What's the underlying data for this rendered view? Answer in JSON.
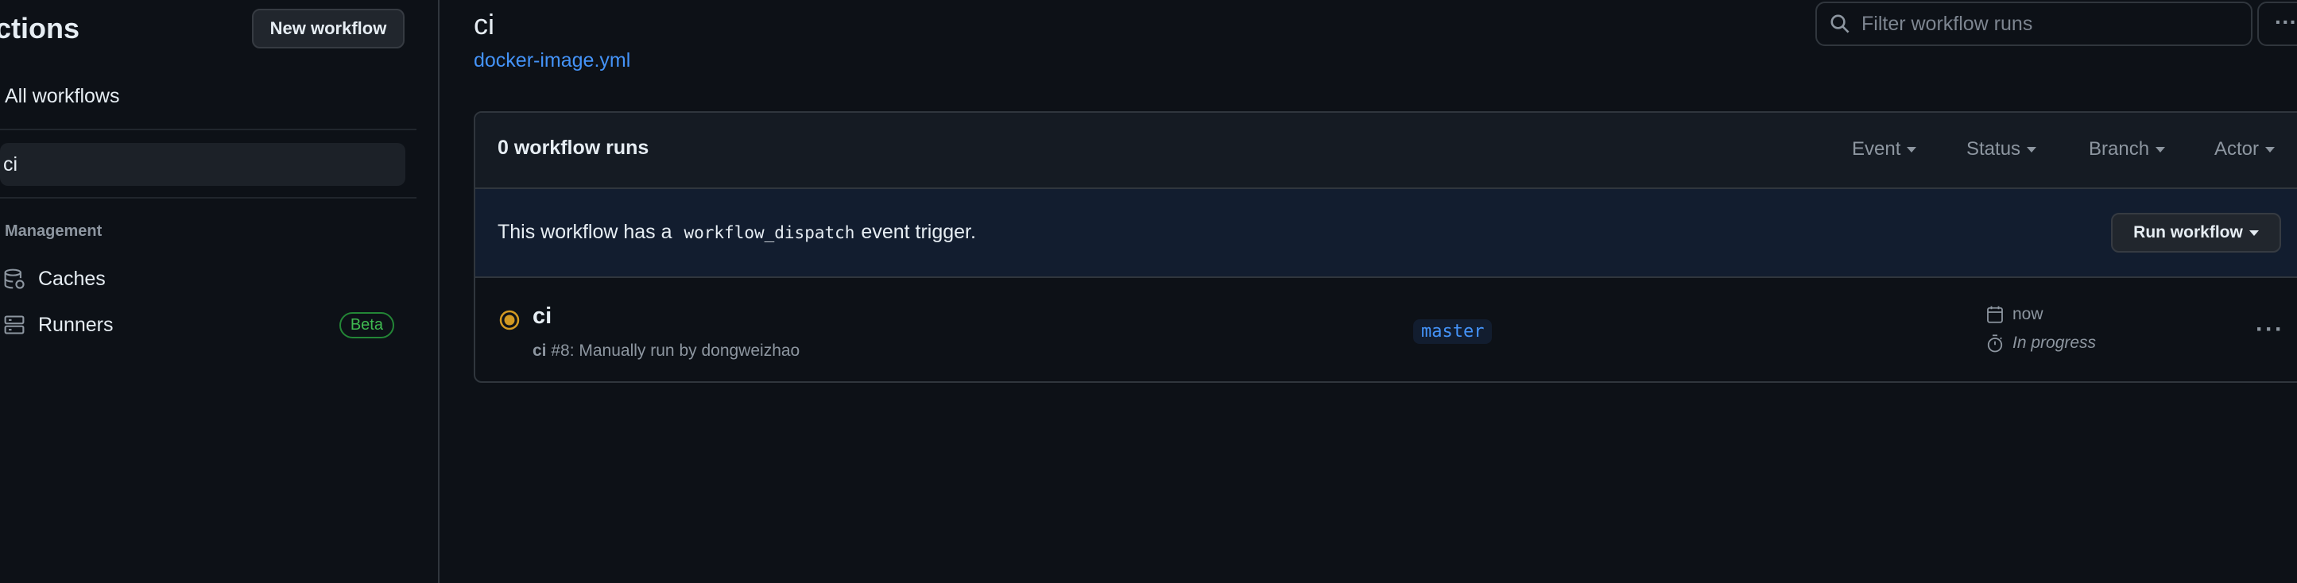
{
  "sidebar": {
    "title": "ctions",
    "new_workflow_label": "New workflow",
    "all_workflows_label": "All workflows",
    "selected_workflow": "ci",
    "management_heading": "Management",
    "caches_label": "Caches",
    "runners_label": "Runners",
    "runners_badge": "Beta"
  },
  "header": {
    "title": "ci",
    "workflow_file": "docker-image.yml",
    "filter_placeholder": "Filter workflow runs",
    "more_label": "···"
  },
  "runs": {
    "count_label": "0 workflow runs",
    "filters": [
      "Event",
      "Status",
      "Branch",
      "Actor"
    ],
    "dispatch_prefix": "This workflow has a",
    "dispatch_code": "workflow_dispatch",
    "dispatch_suffix": "event trigger.",
    "run_workflow_label": "Run workflow",
    "items": [
      {
        "title": "ci",
        "meta_bold": "ci",
        "meta_rest": "#8: Manually run by dongweizhao",
        "branch": "master",
        "time": "now",
        "status": "In progress",
        "status_color": "#d29922",
        "more_label": "···"
      }
    ]
  },
  "colors": {
    "accent": "#4493f8",
    "in_progress": "#d29922",
    "beta": "#3fb950",
    "background": "#0d1117"
  }
}
